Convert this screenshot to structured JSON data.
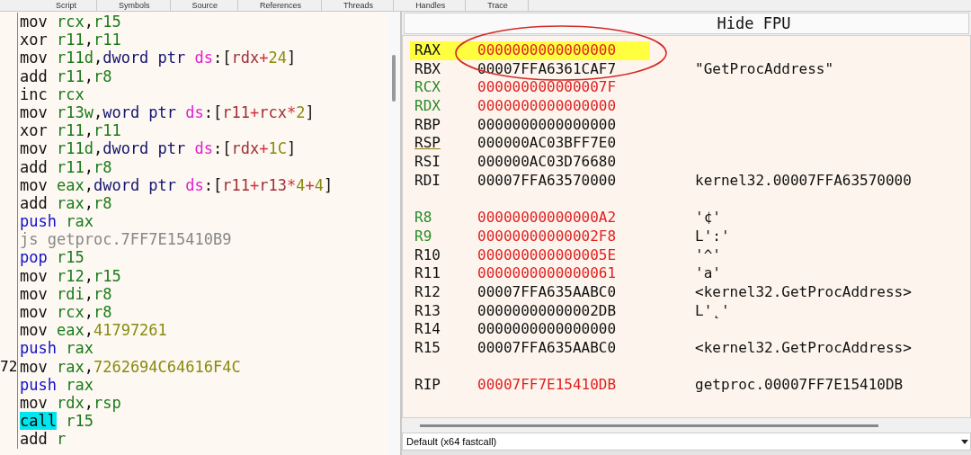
{
  "tabs": [
    {
      "label": "Script",
      "selected": false
    },
    {
      "label": "Symbols",
      "selected": false
    },
    {
      "label": "Source",
      "selected": false
    },
    {
      "label": "References",
      "selected": false
    },
    {
      "label": "Threads",
      "selected": false
    },
    {
      "label": "Handles",
      "selected": false
    },
    {
      "label": "Trace",
      "selected": false
    }
  ],
  "disassembly": {
    "lines": [
      {
        "mnemonic": "mov",
        "kind": "plain",
        "tokens": [
          {
            "t": "rcx",
            "kind": "reg"
          },
          {
            "t": ",",
            "kind": "punct"
          },
          {
            "t": "r15",
            "kind": "reg"
          }
        ]
      },
      {
        "mnemonic": "xor",
        "kind": "plain",
        "tokens": [
          {
            "t": "r11",
            "kind": "reg"
          },
          {
            "t": ",",
            "kind": "punct"
          },
          {
            "t": "r11",
            "kind": "reg"
          }
        ]
      },
      {
        "mnemonic": "mov",
        "kind": "plain",
        "tokens": [
          {
            "t": "r11d",
            "kind": "reg"
          },
          {
            "t": ",",
            "kind": "punct"
          },
          {
            "t": "dword ptr ",
            "kind": "size"
          },
          {
            "t": "ds",
            "kind": "seg"
          },
          {
            "t": ":[",
            "kind": "punct"
          },
          {
            "t": "rdx",
            "kind": "mreg"
          },
          {
            "t": "+",
            "kind": "op"
          },
          {
            "t": "24",
            "kind": "num"
          },
          {
            "t": "]",
            "kind": "punct"
          }
        ]
      },
      {
        "mnemonic": "add",
        "kind": "plain",
        "tokens": [
          {
            "t": "r11",
            "kind": "reg"
          },
          {
            "t": ",",
            "kind": "punct"
          },
          {
            "t": "r8",
            "kind": "reg"
          }
        ]
      },
      {
        "mnemonic": "inc",
        "kind": "plain",
        "tokens": [
          {
            "t": "rcx",
            "kind": "reg"
          }
        ]
      },
      {
        "mnemonic": "mov",
        "kind": "plain",
        "tokens": [
          {
            "t": "r13w",
            "kind": "reg"
          },
          {
            "t": ",",
            "kind": "punct"
          },
          {
            "t": "word ptr ",
            "kind": "size"
          },
          {
            "t": "ds",
            "kind": "seg"
          },
          {
            "t": ":[",
            "kind": "punct"
          },
          {
            "t": "r11",
            "kind": "mreg"
          },
          {
            "t": "+",
            "kind": "op"
          },
          {
            "t": "rcx",
            "kind": "mreg"
          },
          {
            "t": "*",
            "kind": "op"
          },
          {
            "t": "2",
            "kind": "num"
          },
          {
            "t": "]",
            "kind": "punct"
          }
        ]
      },
      {
        "mnemonic": "xor",
        "kind": "plain",
        "tokens": [
          {
            "t": "r11",
            "kind": "reg"
          },
          {
            "t": ",",
            "kind": "punct"
          },
          {
            "t": "r11",
            "kind": "reg"
          }
        ]
      },
      {
        "mnemonic": "mov",
        "kind": "plain",
        "tokens": [
          {
            "t": "r11d",
            "kind": "reg"
          },
          {
            "t": ",",
            "kind": "punct"
          },
          {
            "t": "dword ptr ",
            "kind": "size"
          },
          {
            "t": "ds",
            "kind": "seg"
          },
          {
            "t": ":[",
            "kind": "punct"
          },
          {
            "t": "rdx",
            "kind": "mreg"
          },
          {
            "t": "+",
            "kind": "op"
          },
          {
            "t": "1C",
            "kind": "num"
          },
          {
            "t": "]",
            "kind": "punct"
          }
        ]
      },
      {
        "mnemonic": "add",
        "kind": "plain",
        "tokens": [
          {
            "t": "r11",
            "kind": "reg"
          },
          {
            "t": ",",
            "kind": "punct"
          },
          {
            "t": "r8",
            "kind": "reg"
          }
        ]
      },
      {
        "mnemonic": "mov",
        "kind": "plain",
        "tokens": [
          {
            "t": "eax",
            "kind": "reg"
          },
          {
            "t": ",",
            "kind": "punct"
          },
          {
            "t": "dword ptr ",
            "kind": "size"
          },
          {
            "t": "ds",
            "kind": "seg"
          },
          {
            "t": ":[",
            "kind": "punct"
          },
          {
            "t": "r11",
            "kind": "mreg"
          },
          {
            "t": "+",
            "kind": "op"
          },
          {
            "t": "r13",
            "kind": "mreg"
          },
          {
            "t": "*",
            "kind": "op"
          },
          {
            "t": "4",
            "kind": "num"
          },
          {
            "t": "+",
            "kind": "op"
          },
          {
            "t": "4",
            "kind": "num"
          },
          {
            "t": "]",
            "kind": "punct"
          }
        ]
      },
      {
        "mnemonic": "add",
        "kind": "plain",
        "tokens": [
          {
            "t": "rax",
            "kind": "reg"
          },
          {
            "t": ",",
            "kind": "punct"
          },
          {
            "t": "r8",
            "kind": "reg"
          }
        ]
      },
      {
        "mnemonic": "push",
        "kind": "stack",
        "tokens": [
          {
            "t": "rax",
            "kind": "reg"
          }
        ]
      },
      {
        "mnemonic": "js",
        "kind": "jump",
        "tokens": [
          {
            "t": "getproc.7FF7E15410B9",
            "kind": "target"
          }
        ]
      },
      {
        "mnemonic": "pop",
        "kind": "stack",
        "tokens": [
          {
            "t": "r15",
            "kind": "reg"
          }
        ]
      },
      {
        "mnemonic": "mov",
        "kind": "plain",
        "tokens": [
          {
            "t": "r12",
            "kind": "reg"
          },
          {
            "t": ",",
            "kind": "punct"
          },
          {
            "t": "r15",
            "kind": "reg"
          }
        ]
      },
      {
        "mnemonic": "mov",
        "kind": "plain",
        "tokens": [
          {
            "t": "rdi",
            "kind": "reg"
          },
          {
            "t": ",",
            "kind": "punct"
          },
          {
            "t": "r8",
            "kind": "reg"
          }
        ]
      },
      {
        "mnemonic": "mov",
        "kind": "plain",
        "tokens": [
          {
            "t": "rcx",
            "kind": "reg"
          },
          {
            "t": ",",
            "kind": "punct"
          },
          {
            "t": "r8",
            "kind": "reg"
          }
        ]
      },
      {
        "mnemonic": "mov",
        "kind": "plain",
        "tokens": [
          {
            "t": "eax",
            "kind": "reg"
          },
          {
            "t": ",",
            "kind": "punct"
          },
          {
            "t": "41797261",
            "kind": "num"
          }
        ]
      },
      {
        "mnemonic": "push",
        "kind": "stack",
        "tokens": [
          {
            "t": "rax",
            "kind": "reg"
          }
        ]
      },
      {
        "gutter": "72",
        "mnemonic": "mov",
        "kind": "plain",
        "tokens": [
          {
            "t": "rax",
            "kind": "reg"
          },
          {
            "t": ",",
            "kind": "punct"
          },
          {
            "t": "7262694C64616F4C",
            "kind": "num"
          }
        ]
      },
      {
        "mnemonic": "push",
        "kind": "stack",
        "tokens": [
          {
            "t": "rax",
            "kind": "reg"
          }
        ]
      },
      {
        "mnemonic": "mov",
        "kind": "plain",
        "tokens": [
          {
            "t": "rdx",
            "kind": "reg"
          },
          {
            "t": ",",
            "kind": "punct"
          },
          {
            "t": "rsp",
            "kind": "reg"
          }
        ]
      },
      {
        "mnemonic": "call",
        "kind": "call",
        "tokens": [
          {
            "t": "r15",
            "kind": "reg"
          }
        ]
      },
      {
        "mnemonic": "add",
        "kind": "plain",
        "tokens": [
          {
            "t": "r",
            "kind": "reg"
          }
        ]
      }
    ]
  },
  "registers": {
    "header": "Hide FPU",
    "groups": [
      [
        {
          "name": "RAX",
          "value": "0000000000000000",
          "selected": true,
          "name_changed": false,
          "value_changed": true,
          "underline": false
        },
        {
          "name": "RBX",
          "value": "00007FFA6361CAF7",
          "comment": "\"GetProcAddress\"",
          "selected": false,
          "name_changed": false,
          "value_changed": false,
          "underline": false
        },
        {
          "name": "RCX",
          "value": "000000000000007F",
          "selected": false,
          "name_changed": true,
          "value_changed": true,
          "underline": false
        },
        {
          "name": "RDX",
          "value": "0000000000000000",
          "selected": false,
          "name_changed": true,
          "value_changed": true,
          "underline": false
        },
        {
          "name": "RBP",
          "value": "0000000000000000",
          "selected": false,
          "name_changed": false,
          "value_changed": false,
          "underline": false
        },
        {
          "name": "RSP",
          "value": "000000AC03BFF7E0",
          "selected": false,
          "name_changed": false,
          "value_changed": false,
          "underline": true
        },
        {
          "name": "RSI",
          "value": "000000AC03D76680",
          "selected": false,
          "name_changed": false,
          "value_changed": false,
          "underline": false
        },
        {
          "name": "RDI",
          "value": "00007FFA63570000",
          "comment": "kernel32.00007FFA63570000",
          "selected": false,
          "name_changed": false,
          "value_changed": false,
          "underline": false
        }
      ],
      [
        {
          "name": "R8",
          "value": "00000000000000A2",
          "comment": "'¢'",
          "selected": false,
          "name_changed": true,
          "value_changed": true,
          "underline": false
        },
        {
          "name": "R9",
          "value": "00000000000002F8",
          "comment": "L':'",
          "selected": false,
          "name_changed": true,
          "value_changed": true,
          "underline": false
        },
        {
          "name": "R10",
          "value": "000000000000005E",
          "comment": "'^'",
          "selected": false,
          "name_changed": false,
          "value_changed": true,
          "underline": false
        },
        {
          "name": "R11",
          "value": "0000000000000061",
          "comment": "'a'",
          "selected": false,
          "name_changed": false,
          "value_changed": true,
          "underline": false
        },
        {
          "name": "R12",
          "value": "00007FFA635AABC0",
          "comment": "<kernel32.GetProcAddress>",
          "selected": false,
          "name_changed": false,
          "value_changed": false,
          "underline": false
        },
        {
          "name": "R13",
          "value": "00000000000002DB",
          "comment": "L'˛'",
          "selected": false,
          "name_changed": false,
          "value_changed": false,
          "underline": false
        },
        {
          "name": "R14",
          "value": "0000000000000000",
          "selected": false,
          "name_changed": false,
          "value_changed": false,
          "underline": false
        },
        {
          "name": "R15",
          "value": "00007FFA635AABC0",
          "comment": "<kernel32.GetProcAddress>",
          "selected": false,
          "name_changed": false,
          "value_changed": false,
          "underline": false
        }
      ],
      [
        {
          "name": "RIP",
          "value": "00007FF7E15410DB",
          "comment": "getproc.00007FF7E15410DB",
          "selected": false,
          "name_changed": false,
          "value_changed": true,
          "underline": false
        }
      ]
    ]
  },
  "calling_convention": {
    "value": "Default (x64 fastcall)"
  }
}
